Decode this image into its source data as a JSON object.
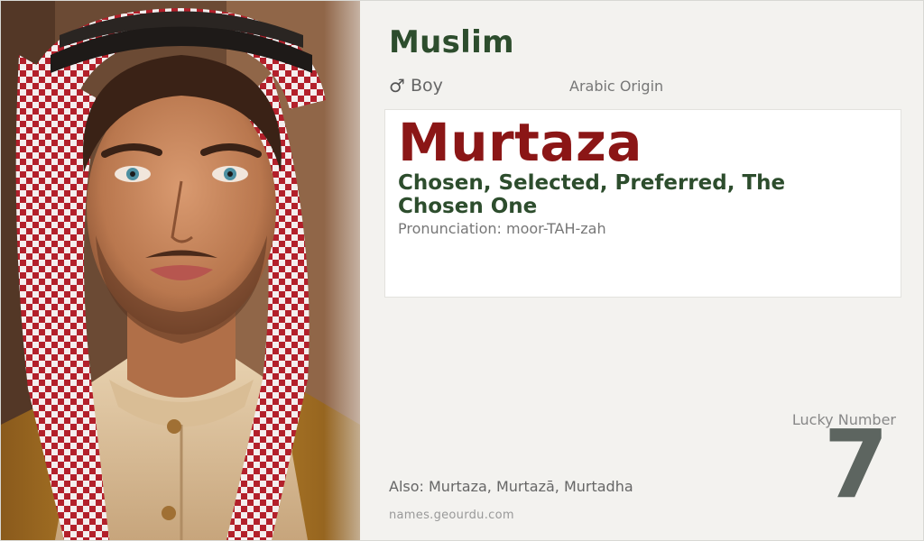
{
  "religion": "Muslim",
  "gender": {
    "icon": "male-symbol-icon",
    "symbol": "♂",
    "label": "Boy"
  },
  "origin": "Arabic Origin",
  "name": "Murtaza",
  "meaning": "Chosen, Selected, Preferred, The Chosen One",
  "pronunciation": "Pronunciation: moor-TAH-zah",
  "lucky": {
    "label": "Lucky Number",
    "number": "7"
  },
  "also": "Also: Murtaza, Murtazā, Murtadha",
  "website": "names.geourdu.com",
  "colors": {
    "religion_text": "#2d4d2d",
    "name_text": "#8b1616",
    "meaning_text": "#2d4d2d",
    "lucky_number": "#5d6560",
    "background": "#f3f2ef"
  }
}
